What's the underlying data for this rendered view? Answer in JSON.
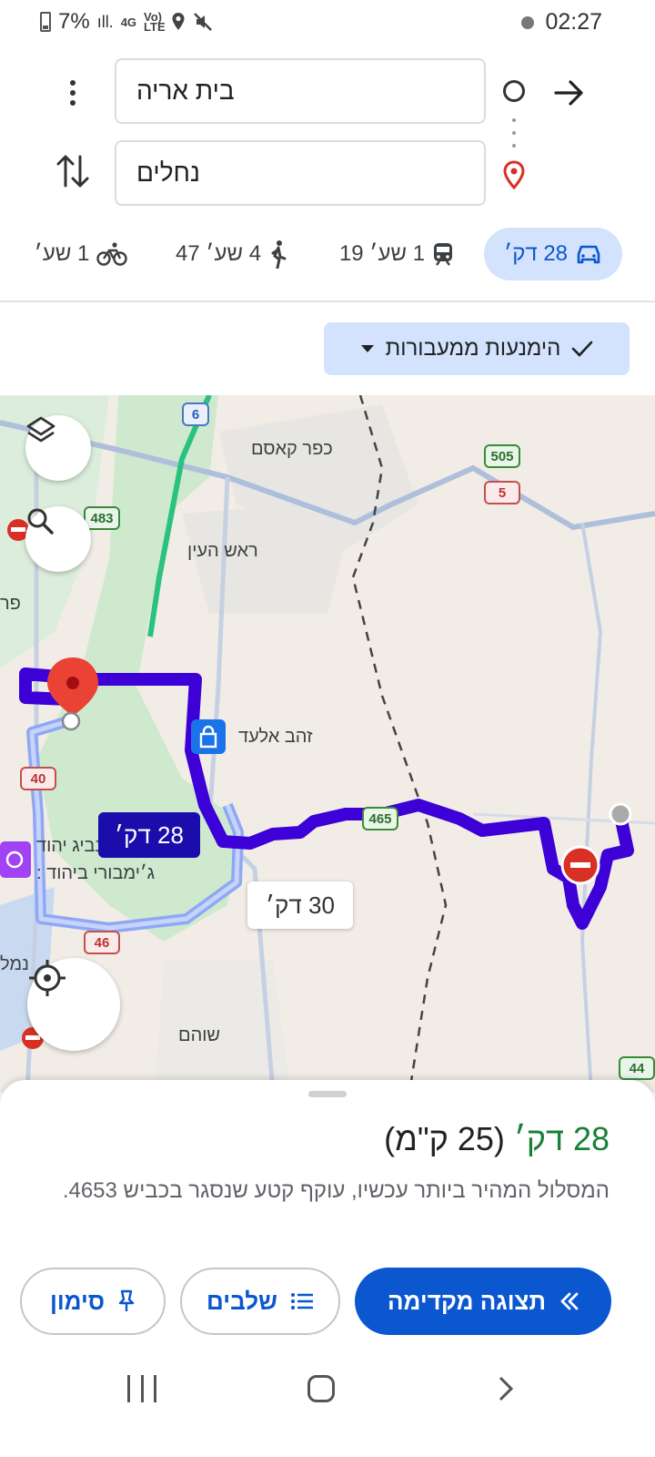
{
  "status_bar": {
    "battery": "7%",
    "network": "4G",
    "volte": "Vo) LTE",
    "time": "02:27"
  },
  "directions": {
    "origin": "בית אריה",
    "destination": "נחלים"
  },
  "modes": {
    "drive": "28 דק׳",
    "transit": "1 שע׳ 19",
    "walk": "4 שע׳ 47",
    "bike": "1 שע׳"
  },
  "chip": {
    "label": "הימנעות ממעבורות"
  },
  "map": {
    "labels": {
      "kafr_qasim": "כפר קאסם",
      "rosh_haayin": "ראש העין",
      "zahav_elad": "זהב אלעד",
      "shoham": "שוהם",
      "poi_line1": "בביג יהוד",
      "poi_line2": "ג׳ימבורי ביהוד :",
      "edge_left1": "פר",
      "edge_left2": "נמל"
    },
    "route_main": "28 דק׳",
    "route_alt": "30 דק׳",
    "roads": [
      "6",
      "483",
      "505",
      "5",
      "465",
      "40",
      "46",
      "44"
    ]
  },
  "summary": {
    "time": "28 דק׳",
    "distance": "(25 ק\"מ)",
    "description": "המסלול המהיר ביותר עכשיו, עוקף קטע שנסגר בכביש 4653."
  },
  "buttons": {
    "preview": "תצוגה מקדימה",
    "steps": "שלבים",
    "pin": "סימון"
  },
  "colors": {
    "route": "#3d00d6",
    "alt_route": "#8fa8f5",
    "accent": "#0b57d0",
    "green_time": "#188038"
  }
}
